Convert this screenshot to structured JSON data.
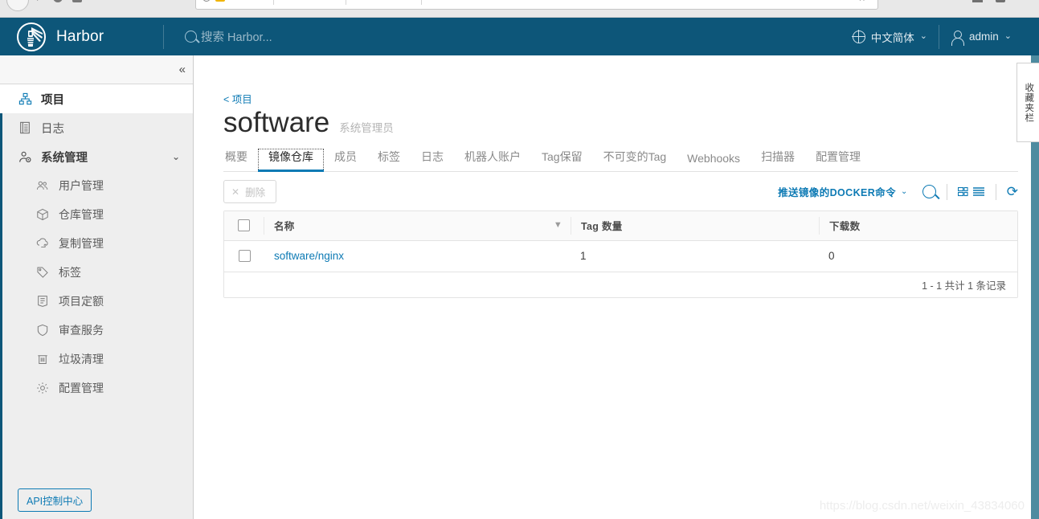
{
  "browser": {
    "back_icon": "back-arrow-icon",
    "forward_icon": "forward-arrow-icon",
    "url_lock_icon": "lock-icon",
    "url_warning_icon": "warning-icon",
    "bookmark_icon": "star-icon",
    "menu_icon": "menu-icon"
  },
  "topnav": {
    "brand": "Harbor",
    "logo_icon": "harbor-lighthouse-logo",
    "search": {
      "icon": "search-icon",
      "placeholder": "搜索 Harbor...",
      "value": ""
    },
    "language": {
      "icon": "globe-icon",
      "label": "中文简体",
      "caret": "⌄"
    },
    "account": {
      "icon": "user-icon",
      "label": "admin",
      "caret": "⌄"
    }
  },
  "sidebar": {
    "collapse_icon": "«",
    "items": [
      {
        "label": "项目",
        "icon": "projects-icon",
        "active": true,
        "level": "top"
      },
      {
        "label": "日志",
        "icon": "logs-icon",
        "active": false,
        "level": "top"
      },
      {
        "label": "系统管理",
        "icon": "admin-user-icon",
        "active": false,
        "level": "group",
        "caret": "⌄"
      },
      {
        "label": "用户管理",
        "icon": "users-icon",
        "active": false,
        "level": "sub"
      },
      {
        "label": "仓库管理",
        "icon": "registry-icon",
        "active": false,
        "level": "sub"
      },
      {
        "label": "复制管理",
        "icon": "replication-icon",
        "active": false,
        "level": "sub"
      },
      {
        "label": "标签",
        "icon": "tag-icon",
        "active": false,
        "level": "sub"
      },
      {
        "label": "项目定额",
        "icon": "quota-icon",
        "active": false,
        "level": "sub"
      },
      {
        "label": "审查服务",
        "icon": "shield-icon",
        "active": false,
        "level": "sub"
      },
      {
        "label": "垃圾清理",
        "icon": "trash-icon",
        "active": false,
        "level": "sub"
      },
      {
        "label": "配置管理",
        "icon": "gear-icon",
        "active": false,
        "level": "sub"
      }
    ],
    "api_button": "API控制中心"
  },
  "page": {
    "breadcrumb": "< 项目",
    "title": "software",
    "role": "系统管理员",
    "tabs": [
      {
        "label": "概要",
        "active": false
      },
      {
        "label": "镜像仓库",
        "active": true
      },
      {
        "label": "成员",
        "active": false
      },
      {
        "label": "标签",
        "active": false
      },
      {
        "label": "日志",
        "active": false
      },
      {
        "label": "机器人账户",
        "active": false
      },
      {
        "label": "Tag保留",
        "active": false
      },
      {
        "label": "不可变的Tag",
        "active": false
      },
      {
        "label": "Webhooks",
        "active": false
      },
      {
        "label": "扫描器",
        "active": false
      },
      {
        "label": "配置管理",
        "active": false
      }
    ]
  },
  "toolbar": {
    "delete_label": "删除",
    "delete_icon": "close-x-icon",
    "delete_disabled": true,
    "push_command_label": "推送镜像的DOCKER命令",
    "push_command_caret": "⌄",
    "search_icon": "search-icon",
    "view_grid_icon": "grid-view-icon",
    "view_list_icon": "list-view-icon",
    "refresh_icon": "refresh-icon",
    "refresh_glyph": "⟳"
  },
  "table": {
    "select_all_checked": false,
    "columns": [
      {
        "label": "名称",
        "filterable": true
      },
      {
        "label": "Tag 数量",
        "filterable": false
      },
      {
        "label": "下载数",
        "filterable": false
      }
    ],
    "filter_icon": "filter-icon",
    "rows": [
      {
        "checked": false,
        "name": "software/nginx",
        "tag_count": "1",
        "downloads": "0"
      }
    ],
    "footer": "1 - 1 共计 1 条记录"
  },
  "overlay": {
    "watermark": "https://blog.csdn.net/weixin_43834060",
    "side_tab_text": "收藏夹栏"
  },
  "colors": {
    "header_bg": "#0d5679",
    "accent_blue": "#0d7ab4",
    "sidebar_bg": "#eeeeee",
    "content_bg": "#ffffff",
    "muted_text": "#8a8a8a"
  }
}
